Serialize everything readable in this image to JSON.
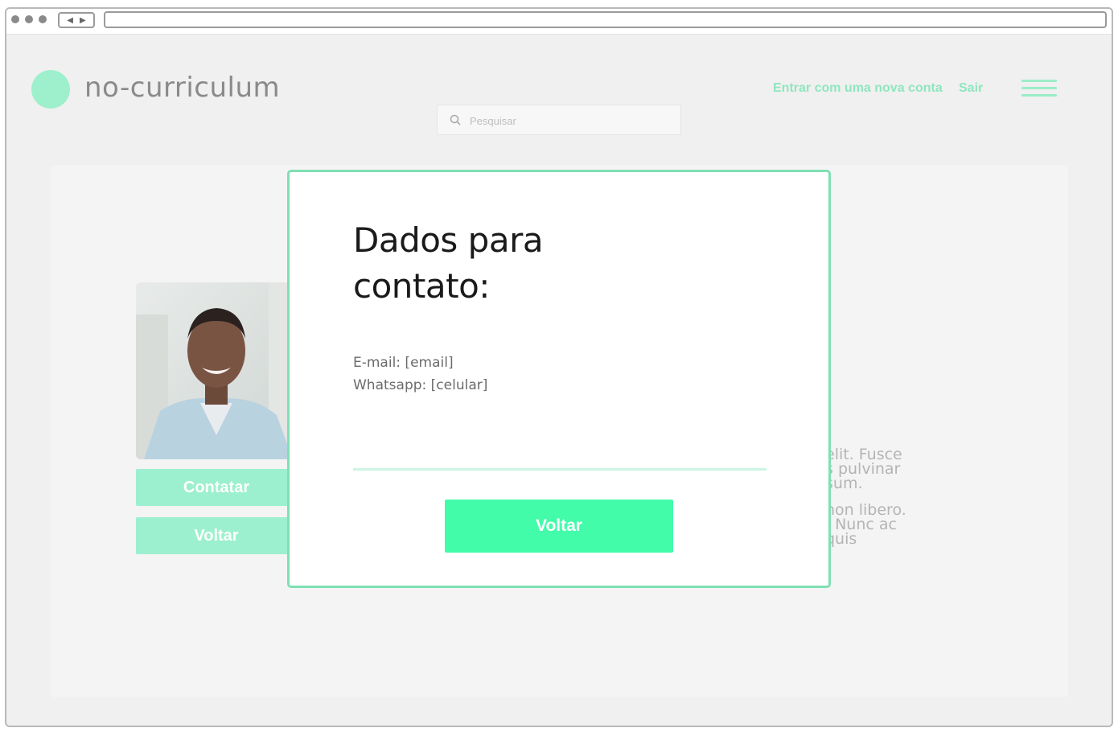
{
  "header": {
    "logo_text": "no-curriculum",
    "nav": {
      "new_account": "Entrar com uma nova conta",
      "logout": "Sair"
    },
    "search": {
      "placeholder": "Pesquisar"
    }
  },
  "profile": {
    "buttons": {
      "contact": "Contatar",
      "back": "Voltar"
    },
    "description_fragments": {
      "line1": "elit. Fusce",
      "line2": "s pulvinar",
      "line3": "sum.",
      "line4": "non libero.",
      "line5": ". Nunc ac",
      "line6": "quis"
    }
  },
  "modal": {
    "title_line1": "Dados para",
    "title_line2": "contato:",
    "email": "E-mail: [email]",
    "whatsapp": "Whatsapp: [celular]",
    "back_button": "Voltar"
  },
  "colors": {
    "accent": "#42fcaa",
    "accent_light": "#9cf0cf",
    "modal_border": "#7fdfb3",
    "logo": "#9ef0cc"
  }
}
